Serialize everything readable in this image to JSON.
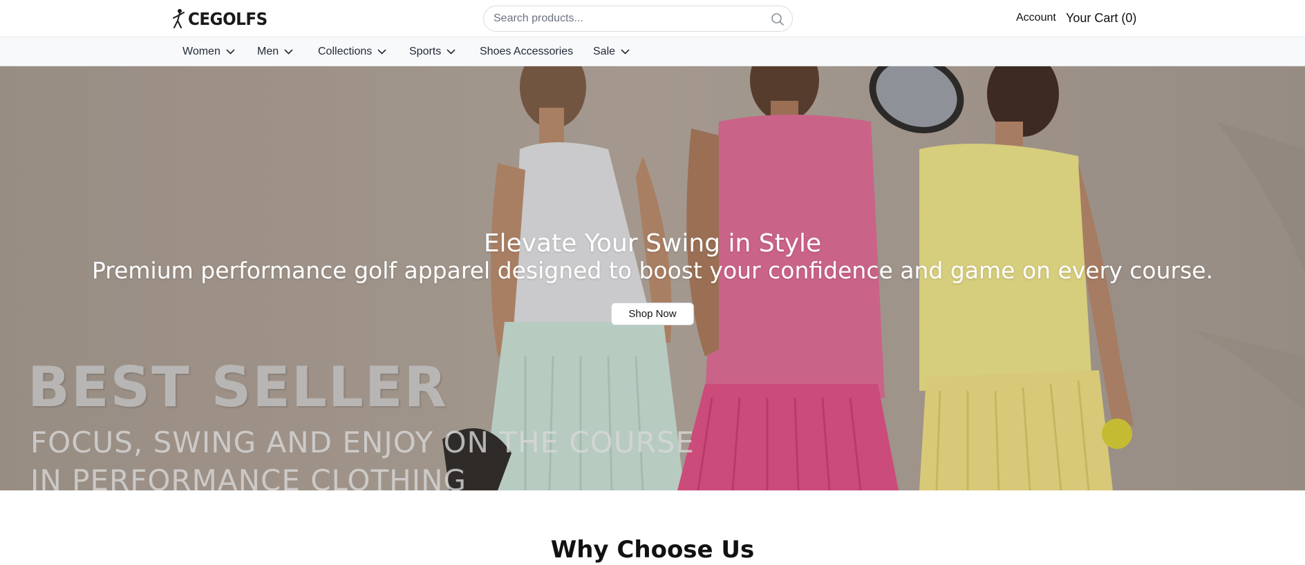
{
  "header": {
    "logo_text": "CEGOLFS",
    "search_placeholder": "Search products...",
    "account_label": "Account",
    "cart_label": "Your Cart (0)"
  },
  "nav": {
    "items": [
      {
        "label": "Women",
        "has_dropdown": true
      },
      {
        "label": "Men",
        "has_dropdown": true
      },
      {
        "label": "Collections",
        "has_dropdown": true
      },
      {
        "label": "Sports",
        "has_dropdown": true
      },
      {
        "label": "Shoes Accessories",
        "has_dropdown": false
      },
      {
        "label": "Sale",
        "has_dropdown": true
      }
    ]
  },
  "hero": {
    "title": "Elevate Your Swing in Style",
    "subtitle": "Premium performance golf apparel designed to boost your confidence and game on every course.",
    "cta_label": "Shop Now",
    "banner_headline": "BEST SELLER",
    "banner_tagline_1": "FOCUS, SWING AND ENJOY ON THE COURSE",
    "banner_tagline_2": "IN PERFORMANCE CLOTHING"
  },
  "section": {
    "heading": "Why Choose Us"
  },
  "colors": {
    "hero_bg": "#a79a90",
    "top_white": "#dfe0e3",
    "top_pink": "#df6a96",
    "top_yellow": "#ece389",
    "skirt_mint": "#c9e1d7",
    "skirt_pink": "#e04f86",
    "skirt_yellow": "#eedf83",
    "nav_bg": "#f8f9fa"
  }
}
